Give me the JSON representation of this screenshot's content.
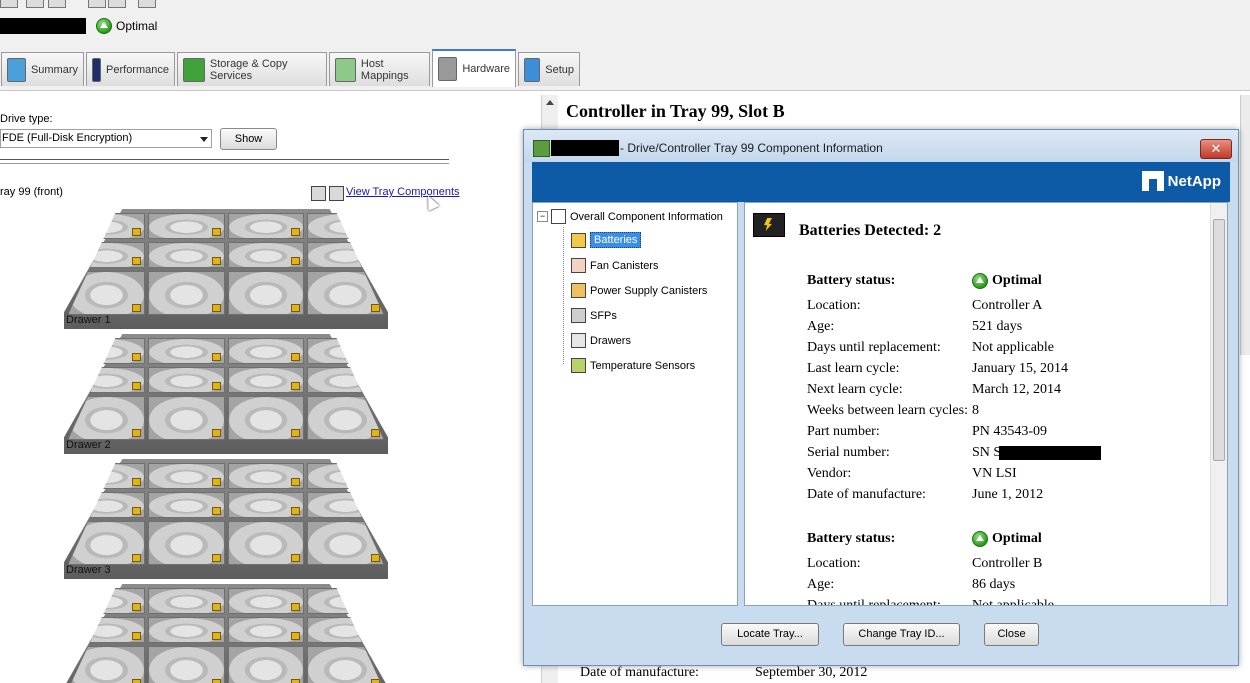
{
  "app": {
    "status": "Optimal"
  },
  "tabs": [
    {
      "label": "Summary"
    },
    {
      "label": "Performance"
    },
    {
      "label": "Storage & Copy Services"
    },
    {
      "label": "Host Mappings"
    },
    {
      "label": "Hardware"
    },
    {
      "label": "Setup"
    }
  ],
  "left": {
    "drive_type_label": "Drive type:",
    "drive_type_value": "FDE (Full-Disk Encryption)",
    "show_button": "Show",
    "tray_label": "ray 99 (front)",
    "view_link": "View Tray Components",
    "drawers": [
      {
        "label": "Drawer 1"
      },
      {
        "label": "Drawer 2"
      },
      {
        "label": "Drawer 3"
      }
    ]
  },
  "background_panel": {
    "title": "Controller in Tray 99, Slot B",
    "row": {
      "label": "Date of manufacture:",
      "value": "September 30, 2012"
    }
  },
  "dialog": {
    "title": "- Drive/Controller Tray 99 Component Information",
    "close": "✕",
    "brand": "NetApp",
    "tree": {
      "root": "Overall Component Information",
      "items": [
        {
          "label": "Batteries",
          "icon": "battery-icon"
        },
        {
          "label": "Fan Canisters",
          "icon": "fan-icon"
        },
        {
          "label": "Power Supply Canisters",
          "icon": "power-supply-icon"
        },
        {
          "label": "SFPs",
          "icon": "sfp-icon"
        },
        {
          "label": "Drawers",
          "icon": "drawer-icon"
        },
        {
          "label": "Temperature Sensors",
          "icon": "temperature-icon"
        }
      ]
    },
    "detail": {
      "heading": "Batteries Detected: 2",
      "batteries": [
        {
          "status_label": "Battery status:",
          "status": "Optimal",
          "rows": [
            {
              "k": "Location:",
              "v": "Controller A"
            },
            {
              "k": "Age:",
              "v": "521 days"
            },
            {
              "k": "Days until replacement:",
              "v": "Not applicable"
            },
            {
              "k": "Last learn cycle:",
              "v": "January 15, 2014"
            },
            {
              "k": "Next learn cycle:",
              "v": "March 12, 2014"
            },
            {
              "k": "Weeks between learn cycles:",
              "v": "8"
            },
            {
              "k": "Part number:",
              "v": "PN 43543-09"
            },
            {
              "k": "Serial number:",
              "v": "SN S"
            },
            {
              "k": "Vendor:",
              "v": "VN LSI"
            },
            {
              "k": "Date of manufacture:",
              "v": "June 1, 2012"
            }
          ]
        },
        {
          "status_label": "Battery status:",
          "status": "Optimal",
          "rows": [
            {
              "k": "Location:",
              "v": "Controller B"
            },
            {
              "k": "Age:",
              "v": "86 days"
            },
            {
              "k": "Days until replacement:",
              "v": "Not applicable"
            }
          ]
        }
      ]
    },
    "buttons": {
      "locate": "Locate Tray...",
      "change_id": "Change Tray ID...",
      "close": "Close"
    }
  }
}
